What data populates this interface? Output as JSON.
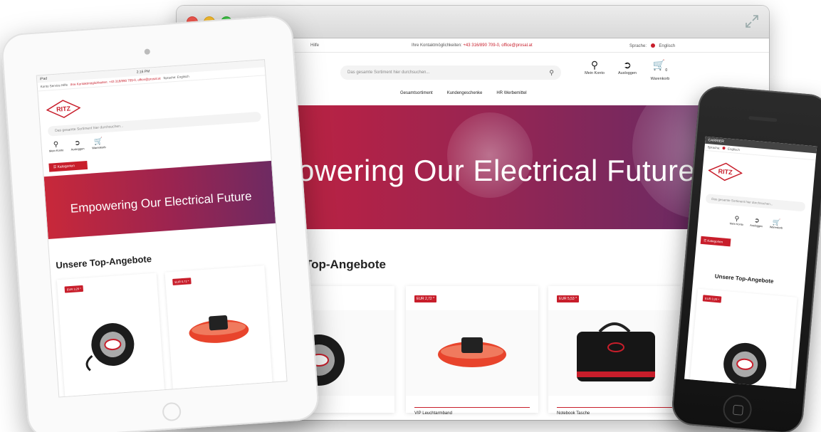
{
  "brand": {
    "logo_text": "RITZ",
    "accent_color": "#c81e2b"
  },
  "desktop": {
    "topbar": {
      "left_text": "Hilfe",
      "contact_label": "Ihre Kontaktmöglichkeiten:",
      "contact_value": "+43 316/890 709-0, office@prosal.at",
      "language_label": "Sprache:",
      "language_value": "Englisch"
    },
    "search": {
      "placeholder": "Das gesamte Sortiment hier durchsuchen..."
    },
    "actions": [
      {
        "label": "Mein Konto",
        "icon": "user-icon"
      },
      {
        "label": "Ausloggen",
        "icon": "logout-icon"
      },
      {
        "label": "Warenkorb",
        "icon": "cart-icon",
        "count": "0"
      }
    ],
    "nav": [
      "Gesamtsortiment",
      "Kundengeschenke",
      "HR Werbemittel"
    ],
    "hero_title": "owering Our Electrical Future",
    "section_title": "Top-Angebote",
    "products": [
      {
        "price": "",
        "name": ""
      },
      {
        "price": "EUR 2,72 *",
        "name": "VIP Leuchtarmband"
      },
      {
        "price": "EUR 5,53 *",
        "name": "Notebook Tasche"
      }
    ]
  },
  "tablet": {
    "status_left": "iPad",
    "status_time": "2:16 PM",
    "topbar_left": "Konto    Service    Hilfe",
    "contact": "Ihre Kontaktmöglichkeiten: +43 316/890 709-0, office@prosal.at",
    "language": "Sprache:  Englisch",
    "search_placeholder": "Das gesamte Sortiment hier durchsuchen...",
    "actions": [
      {
        "label": "Mein Konto"
      },
      {
        "label": "Ausloggen"
      },
      {
        "label": "Warenkorb"
      }
    ],
    "category_button": "Kategorien",
    "hero_title": "Empowering Our Electrical Future",
    "section_title": "Unsere Top-Angebote",
    "products": [
      {
        "price": "EUR 3,25 *"
      },
      {
        "price": "EUR 0,72 *"
      }
    ]
  },
  "phone": {
    "status": "CARRIER",
    "language_label": "Sprache:",
    "language_value": "Englisch",
    "search_placeholder": "Das gesamte Sortiment hier durchsuchen...",
    "actions": [
      {
        "label": "Mein Konto"
      },
      {
        "label": "Ausloggen"
      },
      {
        "label": "Warenkorb"
      }
    ],
    "category_button": "Kategorien",
    "section_title": "Unsere Top-Angebote",
    "products": [
      {
        "price": "EUR 3,25 *"
      }
    ]
  }
}
